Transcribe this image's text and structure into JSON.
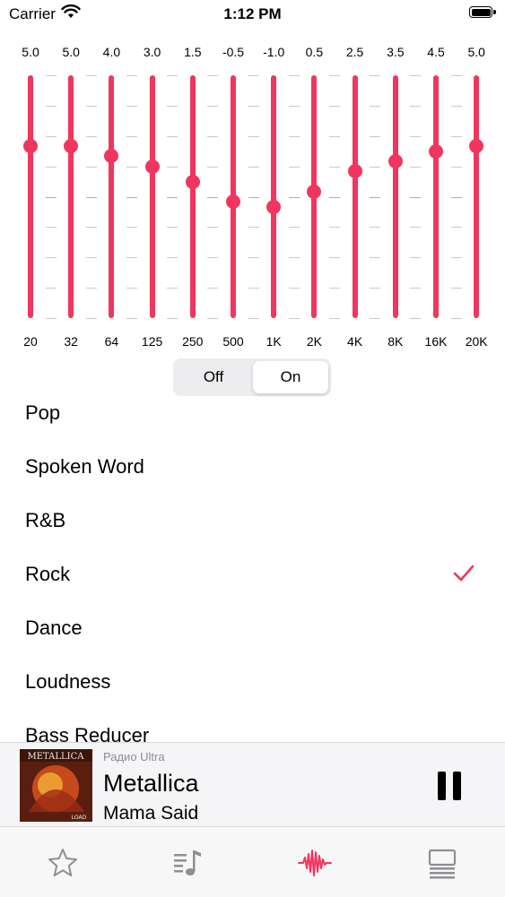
{
  "status_bar": {
    "carrier": "Carrier",
    "time": "1:12 PM"
  },
  "equalizer": {
    "bands": [
      {
        "freq": "20",
        "gain": "5.0",
        "value": 5.0
      },
      {
        "freq": "32",
        "gain": "5.0",
        "value": 5.0
      },
      {
        "freq": "64",
        "gain": "4.0",
        "value": 4.0
      },
      {
        "freq": "125",
        "gain": "3.0",
        "value": 3.0
      },
      {
        "freq": "250",
        "gain": "1.5",
        "value": 1.5
      },
      {
        "freq": "500",
        "gain": "-0.5",
        "value": -0.5
      },
      {
        "freq": "1K",
        "gain": "-1.0",
        "value": -1.0
      },
      {
        "freq": "2K",
        "gain": "0.5",
        "value": 0.5
      },
      {
        "freq": "4K",
        "gain": "2.5",
        "value": 2.5
      },
      {
        "freq": "8K",
        "gain": "3.5",
        "value": 3.5
      },
      {
        "freq": "16K",
        "gain": "4.5",
        "value": 4.5
      },
      {
        "freq": "20K",
        "gain": "5.0",
        "value": 5.0
      }
    ],
    "range": [
      -12,
      12
    ],
    "accent_color": "#f0365e"
  },
  "toggle": {
    "off_label": "Off",
    "on_label": "On",
    "selected": "On"
  },
  "presets": {
    "items": [
      {
        "label": "Pop",
        "selected": false
      },
      {
        "label": "Spoken Word",
        "selected": false
      },
      {
        "label": "R&B",
        "selected": false
      },
      {
        "label": "Rock",
        "selected": true
      },
      {
        "label": "Dance",
        "selected": false
      },
      {
        "label": "Loudness",
        "selected": false
      },
      {
        "label": "Bass Reducer",
        "selected": false
      }
    ]
  },
  "now_playing": {
    "station": "Радио Ultra",
    "artist": "Metallica",
    "track": "Mama Said",
    "album_art_text": "METALLICA",
    "album_art_sub": "LOAD"
  },
  "tab_bar": {
    "tabs": [
      {
        "icon": "star-icon"
      },
      {
        "icon": "music-list-icon"
      },
      {
        "icon": "waveform-icon",
        "active": true
      },
      {
        "icon": "library-icon"
      }
    ],
    "active_color": "#f0365e",
    "inactive_color": "#8e8e93"
  }
}
